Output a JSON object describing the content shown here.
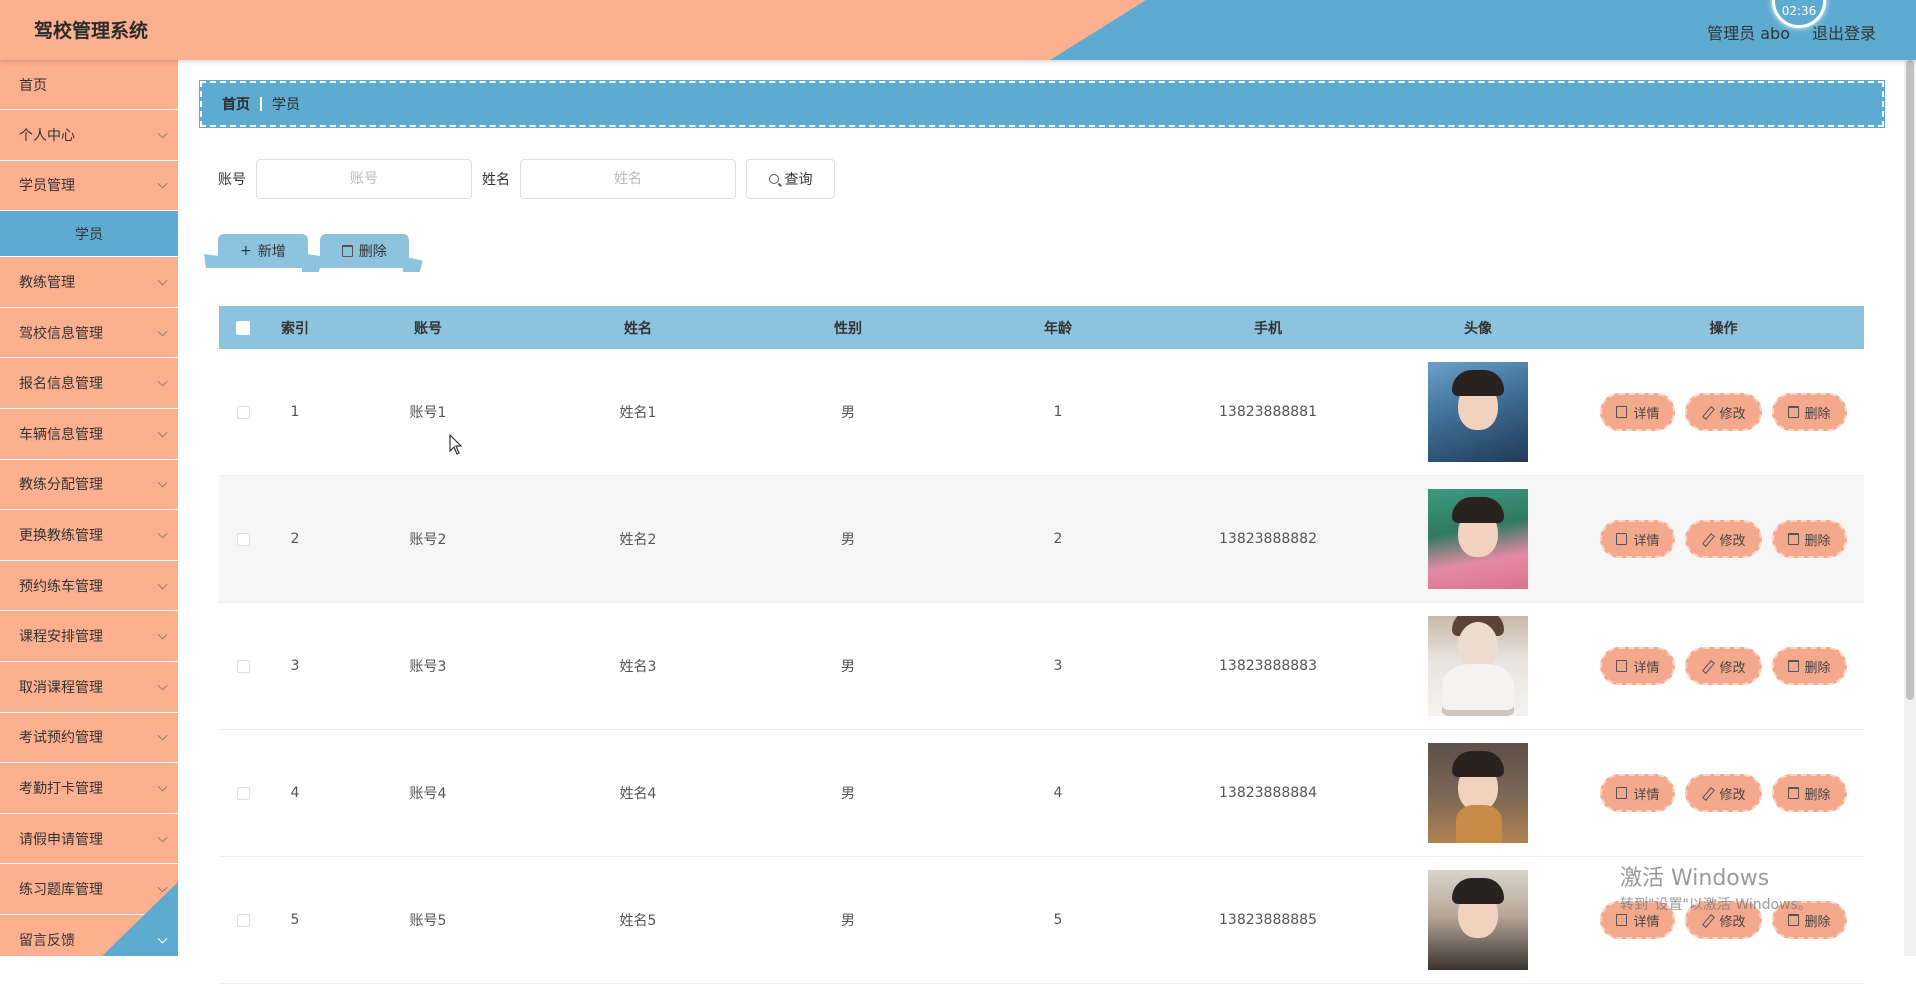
{
  "header": {
    "title": "驾校管理系统",
    "user_label": "管理员 abo",
    "logout_label": "退出登录",
    "clock_time": "02:36"
  },
  "sidebar": {
    "items": [
      {
        "label": "首页",
        "has_arrow": false
      },
      {
        "label": "个人中心",
        "has_arrow": true
      },
      {
        "label": "学员管理",
        "has_arrow": true
      },
      {
        "label": "学员",
        "sub": true
      },
      {
        "label": "教练管理",
        "has_arrow": true
      },
      {
        "label": "驾校信息管理",
        "has_arrow": true
      },
      {
        "label": "报名信息管理",
        "has_arrow": true
      },
      {
        "label": "车辆信息管理",
        "has_arrow": true
      },
      {
        "label": "教练分配管理",
        "has_arrow": true
      },
      {
        "label": "更换教练管理",
        "has_arrow": true
      },
      {
        "label": "预约练车管理",
        "has_arrow": true
      },
      {
        "label": "课程安排管理",
        "has_arrow": true
      },
      {
        "label": "取消课程管理",
        "has_arrow": true
      },
      {
        "label": "考试预约管理",
        "has_arrow": true
      },
      {
        "label": "考勤打卡管理",
        "has_arrow": true
      },
      {
        "label": "请假申请管理",
        "has_arrow": true
      },
      {
        "label": "练习题库管理",
        "has_arrow": true
      },
      {
        "label": "留言反馈",
        "has_arrow": true
      }
    ]
  },
  "breadcrumb": {
    "home": "首页",
    "current": "学员"
  },
  "search": {
    "account_label": "账号",
    "account_placeholder": "账号",
    "name_label": "姓名",
    "name_placeholder": "姓名",
    "query_label": "查询"
  },
  "actions": {
    "add_label": "新增",
    "delete_label": "删除"
  },
  "table": {
    "headers": {
      "index": "索引",
      "account": "账号",
      "name": "姓名",
      "gender": "性别",
      "age": "年龄",
      "phone": "手机",
      "avatar": "头像",
      "ops": "操作"
    },
    "op_labels": {
      "detail": "详情",
      "edit": "修改",
      "delete": "删除"
    },
    "rows": [
      {
        "index": "1",
        "account": "账号1",
        "name": "姓名1",
        "gender": "男",
        "age": "1",
        "phone": "13823888881"
      },
      {
        "index": "2",
        "account": "账号2",
        "name": "姓名2",
        "gender": "男",
        "age": "2",
        "phone": "13823888882"
      },
      {
        "index": "3",
        "account": "账号3",
        "name": "姓名3",
        "gender": "男",
        "age": "3",
        "phone": "13823888883"
      },
      {
        "index": "4",
        "account": "账号4",
        "name": "姓名4",
        "gender": "男",
        "age": "4",
        "phone": "13823888884"
      },
      {
        "index": "5",
        "account": "账号5",
        "name": "姓名5",
        "gender": "男",
        "age": "5",
        "phone": "13823888885"
      }
    ]
  },
  "watermark": {
    "line1": "激活 Windows",
    "line2": "转到\"设置\"以激活 Windows。"
  },
  "colors": {
    "salmon": "#fdb08f",
    "blue": "#5eabd1",
    "light_blue": "#8ec3de",
    "op_button": "#f5a98c"
  }
}
